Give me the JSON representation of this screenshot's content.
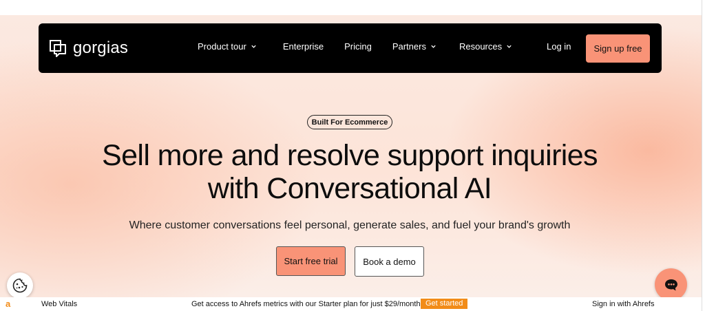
{
  "navbar": {
    "logo_text": "gorgias",
    "links": [
      {
        "label": "Product tour",
        "has_dropdown": true
      },
      {
        "label": "Enterprise",
        "has_dropdown": false
      },
      {
        "label": "Pricing",
        "has_dropdown": false
      },
      {
        "label": "Partners",
        "has_dropdown": true
      },
      {
        "label": "Resources",
        "has_dropdown": true
      }
    ],
    "login_label": "Log in",
    "signup_label": "Sign up free"
  },
  "hero": {
    "badge": "Built For Ecommerce",
    "headline_line1": "Sell more and resolve support inquiries",
    "headline_line2": "with Conversational AI",
    "subhead": "Where customer conversations feel personal, generate sales, and fuel your brand's growth",
    "primary_cta": "Start free trial",
    "secondary_cta": "Book a demo"
  },
  "widgets": {
    "cookie_icon": "cookie-icon",
    "chat_icon": "chat-bubble-icon"
  },
  "ahrefs_bar": {
    "logo": "a",
    "web_vitals": "Web Vitals",
    "promo": "Get access to Ahrefs metrics with our Starter plan for just $29/month.",
    "get_started": "Get started",
    "sign_in": "Sign in with Ahrefs"
  },
  "colors": {
    "accent": "#f99377",
    "navbar_bg": "#000000",
    "ahrefs_orange": "#f28c18"
  }
}
